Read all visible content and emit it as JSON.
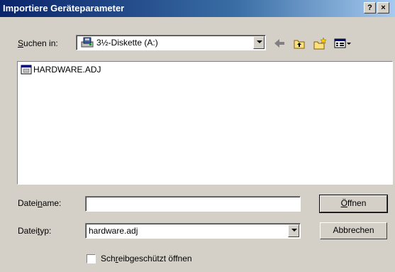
{
  "window": {
    "title": "Importiere Geräteparameter",
    "help_label": "?",
    "close_label": "×"
  },
  "lookin": {
    "label_pre": "",
    "label_ul": "S",
    "label_post": "uchen in:",
    "value": "3½-Diskette (A:)"
  },
  "toolbar": {
    "back_icon": "back-arrow-icon",
    "up_icon": "up-folder-icon",
    "new_folder_icon": "new-folder-icon",
    "view_menu_icon": "view-menu-icon"
  },
  "files": [
    {
      "name": "HARDWARE.ADJ",
      "icon": "file-icon"
    }
  ],
  "filename": {
    "label_pre": "Datei",
    "label_ul": "n",
    "label_post": "ame:",
    "value": ""
  },
  "filetype": {
    "label_pre": "Datei",
    "label_ul": "t",
    "label_post": "yp:",
    "value": "hardware.adj"
  },
  "buttons": {
    "open_ul": "Ö",
    "open_post": "ffnen",
    "cancel": "Abbrechen"
  },
  "readonly": {
    "label_pre": "Sch",
    "label_ul": "r",
    "label_post": "eibgeschützt öffnen",
    "checked": false
  }
}
